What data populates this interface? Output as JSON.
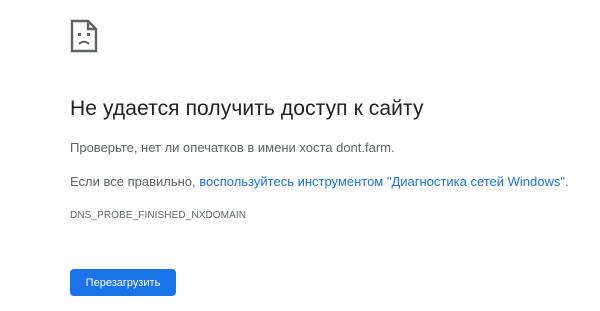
{
  "error_page": {
    "icon": "sad-page-icon",
    "title": "Не удается получить доступ к сайту",
    "check_text": "Проверьте, нет ли опечатков в имени хоста dont.farm.",
    "if_correct_prefix": "Если все правильно, ",
    "diagnostics_link": "воспользуйтесь инструментом \"Диагностика сетей Windows\"",
    "if_correct_suffix": ".",
    "error_code": "DNS_PROBE_FINISHED_NXDOMAIN",
    "reload_label": "Перезагрузить"
  },
  "colors": {
    "accent": "#1a73e8",
    "text_primary": "#202124",
    "text_secondary": "#5f6368",
    "background": "#ffffff"
  }
}
